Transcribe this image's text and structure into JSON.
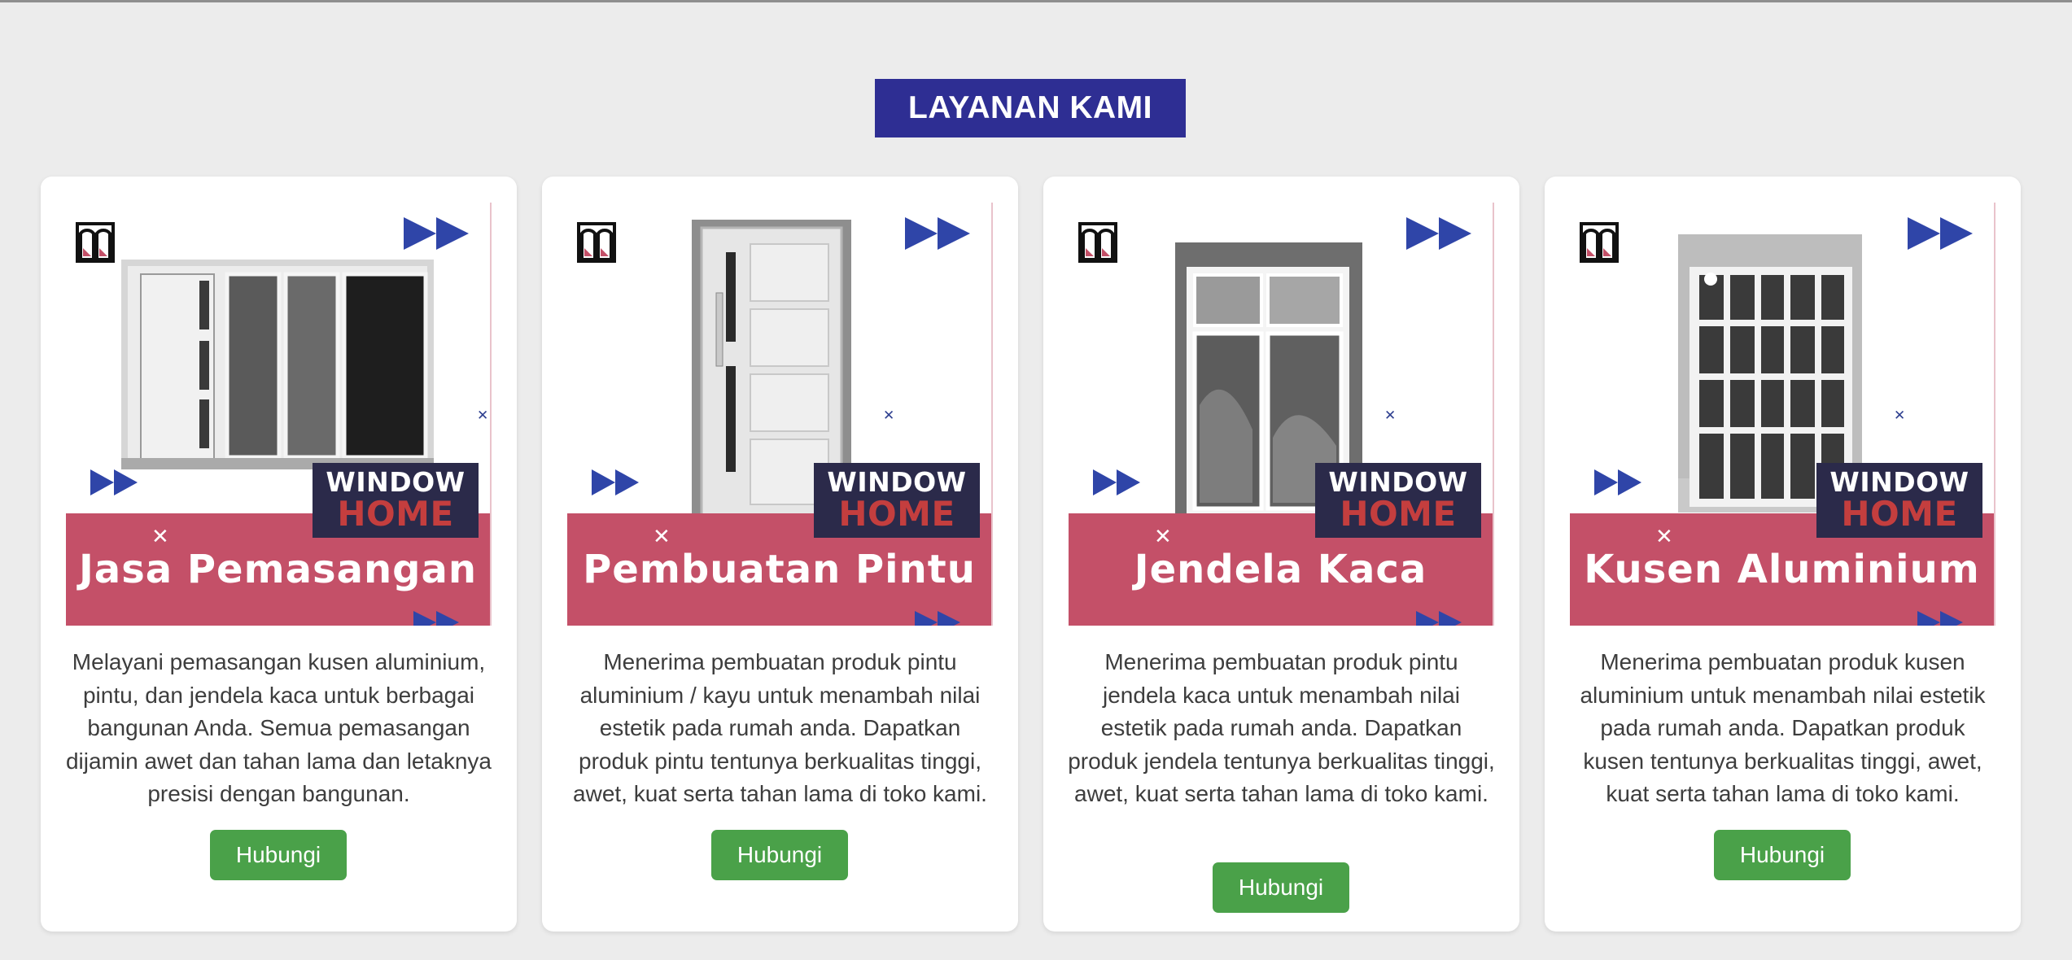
{
  "section": {
    "title": "LAYANAN KAMI"
  },
  "brand": {
    "line1": "WINDOW",
    "line2": "HOME"
  },
  "cards": [
    {
      "banner_title": "Jasa Pemasangan",
      "description": "Melayani pemasangan kusen aluminium, pintu, dan jendela kaca untuk berbagai bangunan Anda. Semua pemasangan dijamin awet dan tahan lama dan letaknya presisi dengan bangunan.",
      "button": "Hubungi"
    },
    {
      "banner_title": "Pembuatan Pintu",
      "description": "Menerima pembuatan produk pintu aluminium / kayu untuk menambah nilai estetik pada rumah anda. Dapatkan produk pintu tentunya berkualitas tinggi, awet, kuat serta tahan lama di toko kami.",
      "button": "Hubungi"
    },
    {
      "banner_title": "Jendela Kaca",
      "description": "Menerima pembuatan produk pintu jendela kaca untuk menambah nilai estetik pada rumah anda. Dapatkan produk jendela tentunya berkualitas tinggi, awet, kuat serta tahan lama di toko kami.",
      "button": "Hubungi"
    },
    {
      "banner_title": "Kusen Aluminium",
      "description": "Menerima pembuatan produk kusen aluminium untuk menambah nilai estetik pada rumah anda. Dapatkan produk kusen tentunya berkualitas tinggi, awet, kuat serta tahan lama di toko kami.",
      "button": "Hubungi"
    }
  ],
  "colors": {
    "title_bg": "#2e2e93",
    "band_red": "#c45068",
    "badge_dark": "#2b2a4a",
    "brand_red": "#c43e3e",
    "arrow_blue": "#2f45a8",
    "button_green": "#4aa149",
    "page_bg": "#ececec"
  },
  "icons": [
    "window-logo-icon",
    "double-arrow-icon",
    "cross-icon"
  ]
}
